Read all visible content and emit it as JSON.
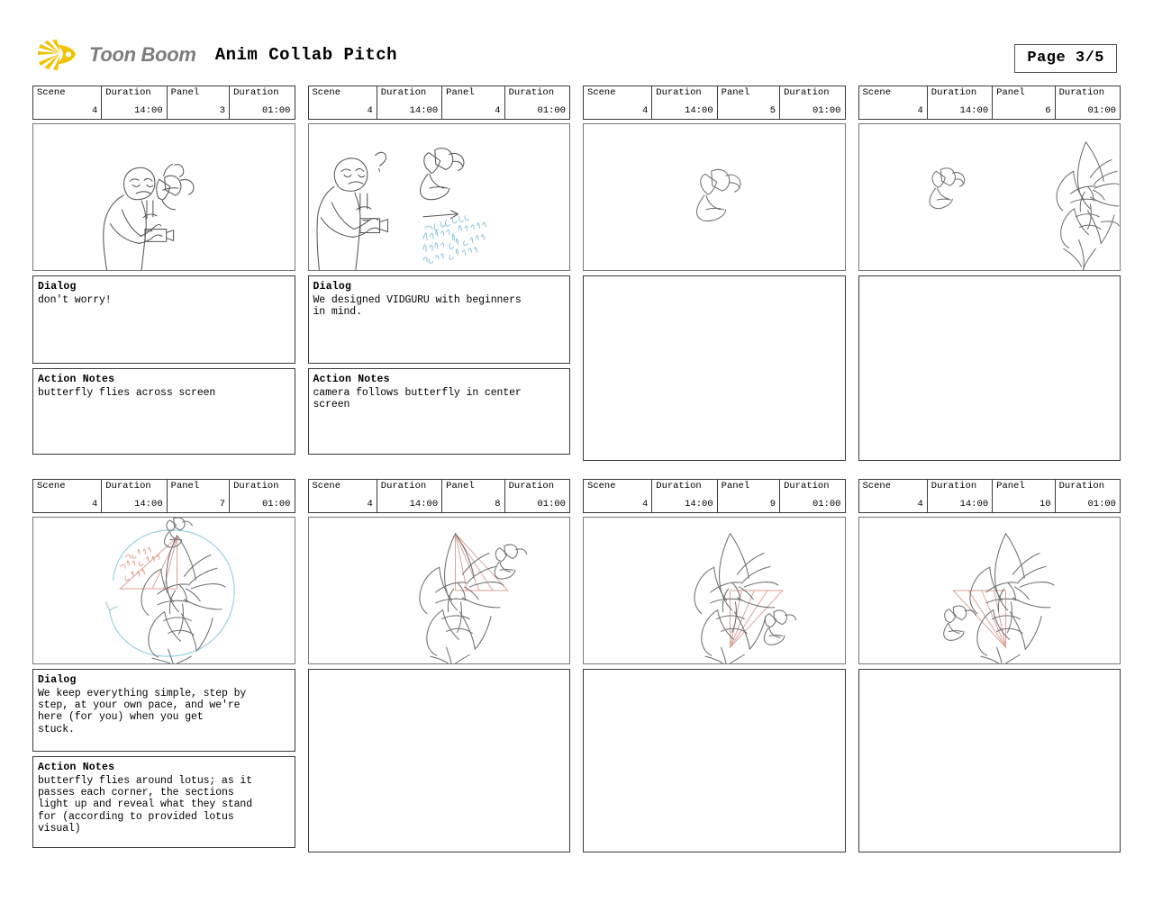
{
  "header": {
    "brand_name": "Toon Boom",
    "logo_icon": "sunburst-icon",
    "document_title": "Anim Collab Pitch",
    "page_label": "Page 3/5"
  },
  "labels": {
    "scene": "Scene",
    "duration": "Duration",
    "panel": "Panel",
    "dialog": "Dialog",
    "action_notes": "Action Notes"
  },
  "panels": [
    {
      "scene": "4",
      "scene_duration": "14:00",
      "panel": "3",
      "panel_duration": "01:00",
      "dialog": "don't worry!",
      "action_notes": "butterfly flies across screen",
      "art": "person-recoiling-from-butterfly",
      "has_notes": true
    },
    {
      "scene": "4",
      "scene_duration": "14:00",
      "panel": "4",
      "panel_duration": "01:00",
      "dialog": "We designed VIDGURU with beginners\nin mind.",
      "action_notes": "camera follows butterfly in center\nscreen",
      "art": "person-with-camera-and-butterfly",
      "annotation": "camera follows butterfly after it reaches center frame",
      "has_notes": true
    },
    {
      "scene": "4",
      "scene_duration": "14:00",
      "panel": "5",
      "panel_duration": "01:00",
      "dialog": "",
      "action_notes": "",
      "art": "butterfly-center",
      "has_notes": false
    },
    {
      "scene": "4",
      "scene_duration": "14:00",
      "panel": "6",
      "panel_duration": "01:00",
      "dialog": "",
      "action_notes": "",
      "art": "butterfly-approaching-lotus",
      "has_notes": false
    },
    {
      "scene": "4",
      "scene_duration": "14:00",
      "panel": "7",
      "panel_duration": "01:00",
      "dialog": "We keep everything simple, step by\nstep, at your own pace, and we're\nhere (for you) when you get\nstuck.",
      "action_notes": "butterfly flies around lotus; as it\npasses each corner, the sections\nlight up and reveal what they stand\nfor (according to provided lotus\nvisual)",
      "art": "lotus-with-circular-path",
      "annotation": "camera pans to first petal",
      "has_notes": true
    },
    {
      "scene": "4",
      "scene_duration": "14:00",
      "panel": "8",
      "panel_duration": "01:00",
      "dialog": "",
      "action_notes": "",
      "art": "lotus-top-right-section-lit",
      "has_notes": false
    },
    {
      "scene": "4",
      "scene_duration": "14:00",
      "panel": "9",
      "panel_duration": "01:00",
      "dialog": "",
      "action_notes": "",
      "art": "lotus-bottom-right-section-lit",
      "has_notes": false
    },
    {
      "scene": "4",
      "scene_duration": "14:00",
      "panel": "10",
      "panel_duration": "01:00",
      "dialog": "",
      "action_notes": "",
      "art": "lotus-bottom-left-section-lit",
      "has_notes": false
    }
  ],
  "colors": {
    "logo_yellow": "#f5c518",
    "brand_gray": "#7d7d7d",
    "border": "#3a3a3a",
    "art_border": "#777777",
    "annotation_blue": "#7ec0d6",
    "annotation_red": "#e08878"
  }
}
